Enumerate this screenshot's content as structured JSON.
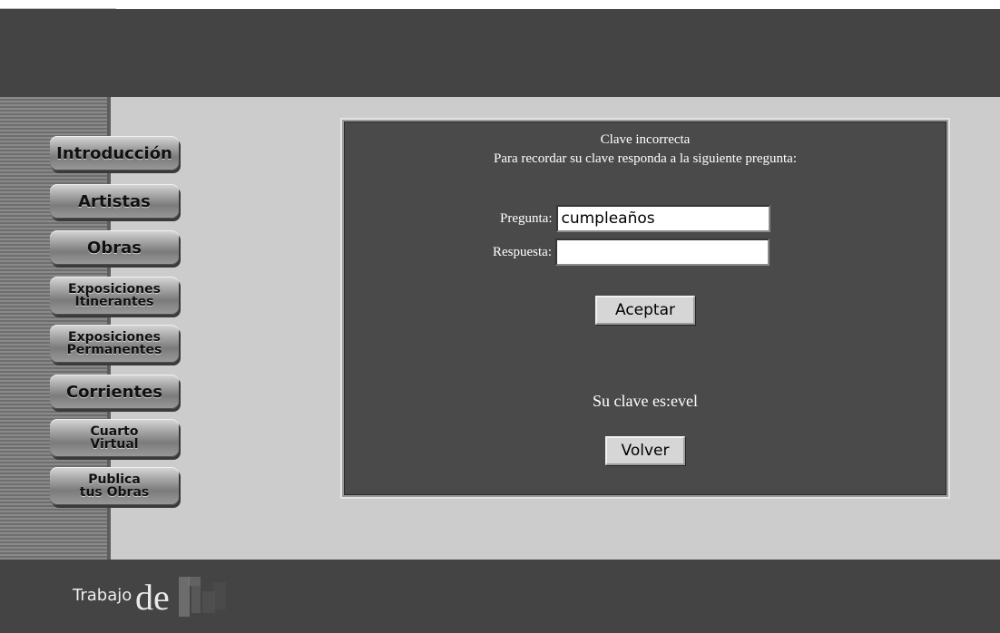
{
  "sidebar": {
    "items": [
      {
        "label": "Introducción",
        "key": "introduccion"
      },
      {
        "label": "Artistas",
        "key": "artistas"
      },
      {
        "label": "Obras",
        "key": "obras"
      },
      {
        "label": "Exposiciones\nItinerantes",
        "key": "exposiciones-itinerantes"
      },
      {
        "label": "Exposiciones\nPermanentes",
        "key": "exposiciones-permanentes"
      },
      {
        "label": "Corrientes",
        "key": "corrientes"
      },
      {
        "label": "Cuarto\nVirtual",
        "key": "cuarto-virtual"
      },
      {
        "label": "Publica\ntus Obras",
        "key": "publica-tus-obras"
      }
    ]
  },
  "panel": {
    "message_title": "Clave incorrecta",
    "message_instruction": "Para recordar su clave responda a la siguiente pregunta:",
    "question_label": "Pregunta:",
    "question_value": "cumpleaños",
    "answer_label": "Respuesta:",
    "answer_value": "",
    "accept_label": "Aceptar",
    "result_text": "Su clave es:evel",
    "back_label": "Volver"
  },
  "footer": {
    "logo_text": "Trabajo",
    "logo_mark": "de"
  },
  "colors": {
    "header_bg": "#444444",
    "main_bg": "#cccccc",
    "panel_bg": "#4a4a4a",
    "text_on_panel": "#ffffff"
  }
}
